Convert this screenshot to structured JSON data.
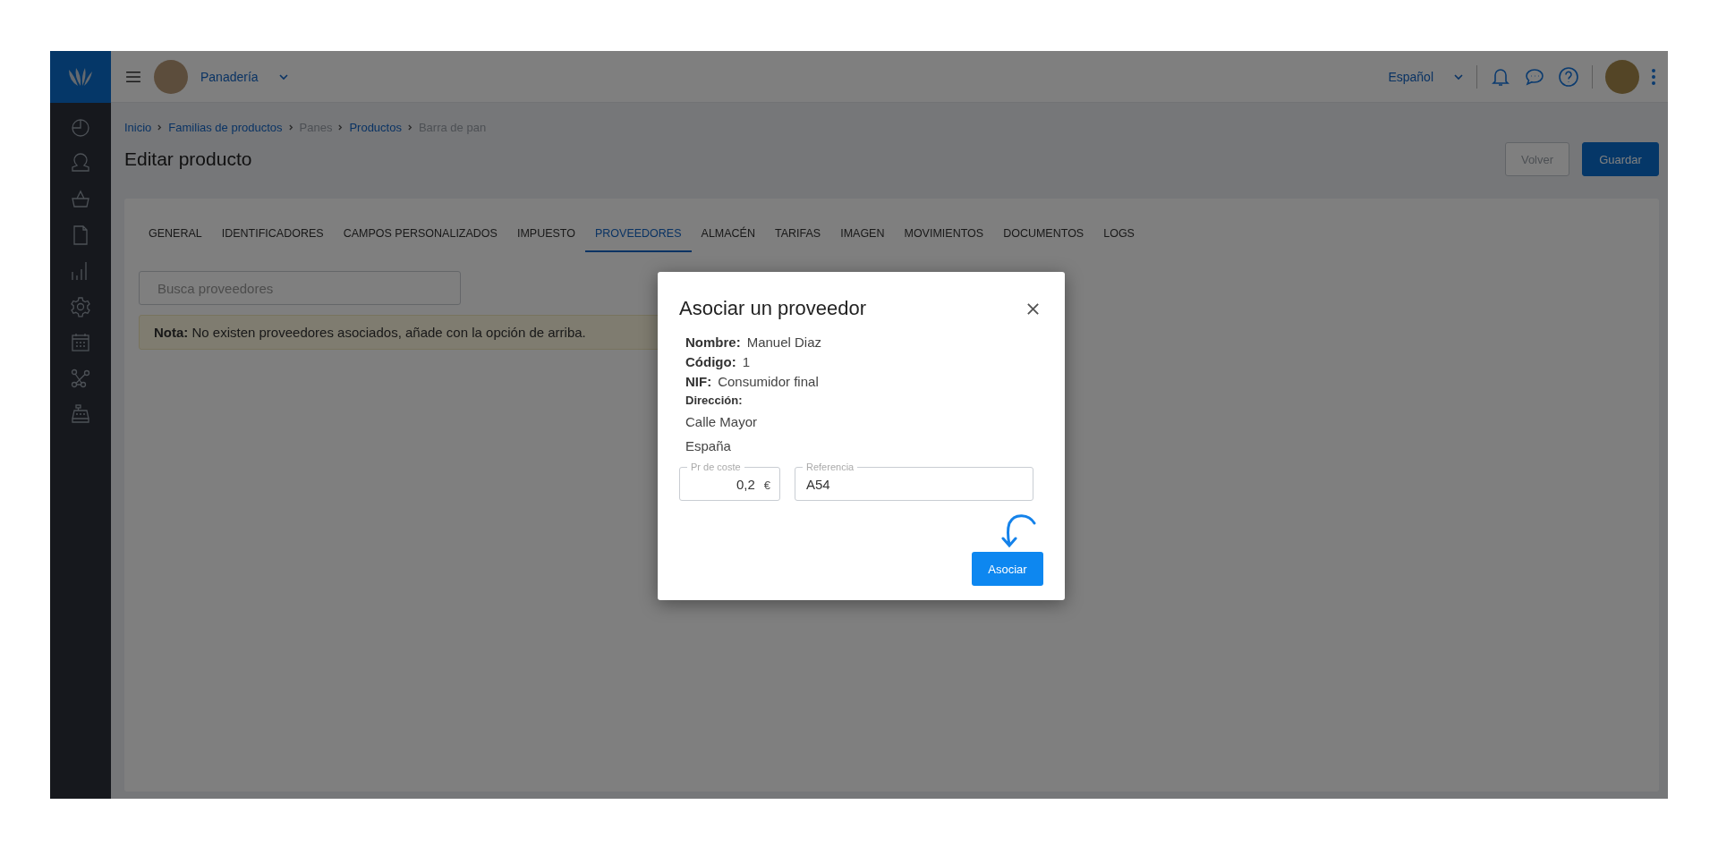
{
  "topbar": {
    "store": "Panadería",
    "language": "Español"
  },
  "breadcrumbs": [
    {
      "label": "Inicio",
      "kind": "link"
    },
    {
      "label": "Familias de productos",
      "kind": "link"
    },
    {
      "label": "Panes",
      "kind": "text"
    },
    {
      "label": "Productos",
      "kind": "link"
    },
    {
      "label": "Barra de pan",
      "kind": "text"
    }
  ],
  "page_title": "Editar producto",
  "actions": [
    {
      "label": "Volver",
      "kind": "secondary"
    },
    {
      "label": "Guardar",
      "kind": "primary"
    }
  ],
  "tabs": [
    {
      "label": "GENERAL",
      "selected": false
    },
    {
      "label": "IDENTIFICADORES",
      "selected": false
    },
    {
      "label": "CAMPOS PERSONALIZADOS",
      "selected": false
    },
    {
      "label": "IMPUESTO",
      "selected": false
    },
    {
      "label": "PROVEEDORES",
      "selected": true
    },
    {
      "label": "ALMACÉN",
      "selected": false
    },
    {
      "label": "TARIFAS",
      "selected": false
    },
    {
      "label": "IMAGEN",
      "selected": false
    },
    {
      "label": "MOVIMIENTOS",
      "selected": false
    },
    {
      "label": "DOCUMENTOS",
      "selected": false
    },
    {
      "label": "LOGS",
      "selected": false
    }
  ],
  "search": {
    "placeholder": "Busca proveedores"
  },
  "note": "**Nota:** No existen proveedores asociados, añade con la opción de arriba.",
  "modal": {
    "title": "Asociar un proveedor",
    "details": [
      {
        "label": "Nombre:",
        "value": "Manuel Diaz"
      },
      {
        "label": "Código:",
        "value": "1"
      },
      {
        "label": "NIF:",
        "value": "Consumidor final"
      }
    ],
    "address_label": "Dirección:",
    "address_lines": [
      "Calle Mayor",
      "España"
    ],
    "cost": {
      "label": "Pr de coste",
      "value": "0,2",
      "suffix": "€"
    },
    "reference": {
      "label": "Referencia",
      "value": "A54"
    },
    "button": "Asociar"
  }
}
